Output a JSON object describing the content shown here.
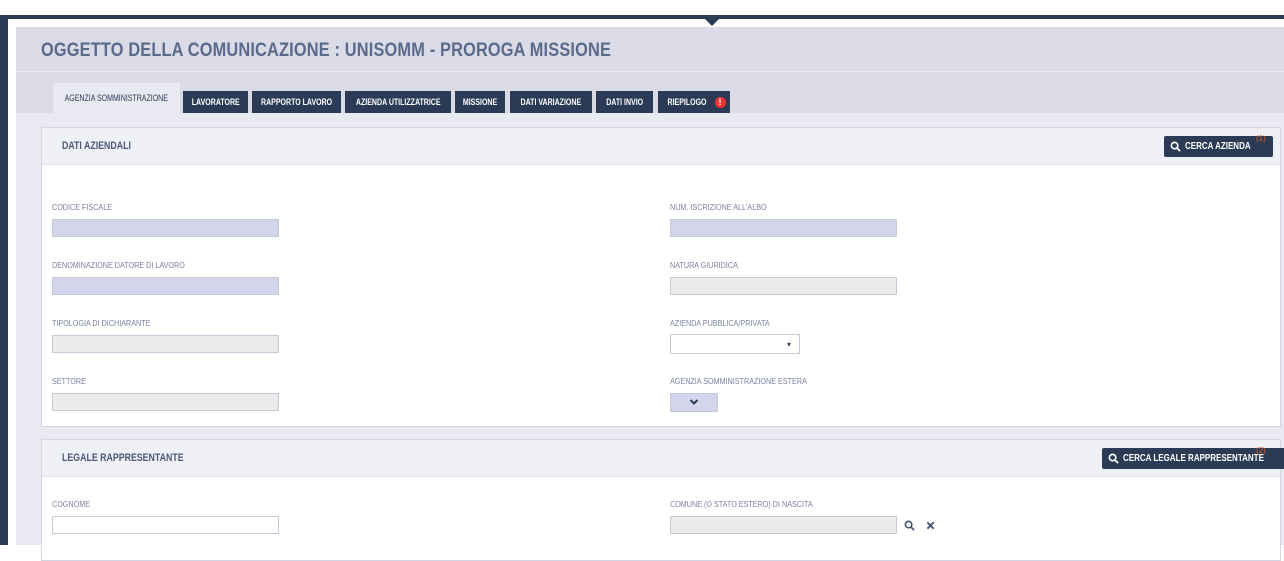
{
  "header": {
    "title": "OGGETTO DELLA COMUNICAZIONE : UNISOMM - PROROGA MISSIONE"
  },
  "tabs": [
    {
      "label": "AGENZIA SOMMINISTRAZIONE",
      "active": true
    },
    {
      "label": "LAVORATORE",
      "active": false
    },
    {
      "label": "RAPPORTO LAVORO",
      "active": false
    },
    {
      "label": "AZIENDA UTILIZZATRICE",
      "active": false
    },
    {
      "label": "MISSIONE",
      "active": false
    },
    {
      "label": "DATI VARIAZIONE",
      "active": false
    },
    {
      "label": "DATI INVIO",
      "active": false
    },
    {
      "label": "RIEPILOGO",
      "active": false,
      "alert": "!"
    }
  ],
  "dati_aziendali": {
    "title": "DATI AZIENDALI",
    "search_label": "CERCA AZIENDA",
    "search_note": "(1)",
    "fields": {
      "codice_fiscale": {
        "label": "CODICE FISCALE",
        "value": ""
      },
      "num_iscrizione": {
        "label": "NUM. ISCRIZIONE ALL'ALBO",
        "value": ""
      },
      "denominazione": {
        "label": "DENOMINAZIONE DATORE DI LAVORO",
        "value": ""
      },
      "natura_giuridica": {
        "label": "NATURA GIURIDICA",
        "value": ""
      },
      "tipologia": {
        "label": "TIPOLOGIA DI DICHIARANTE",
        "value": ""
      },
      "pubblica_privata": {
        "label": "AZIENDA PUBBLICA/PRIVATA",
        "value": ""
      },
      "settore": {
        "label": "SETTORE",
        "value": ""
      },
      "agenzia_estera": {
        "label": "AGENZIA SOMMINISTRAZIONE ESTERA",
        "value": ""
      }
    }
  },
  "legale_rappresentante": {
    "title": "LEGALE RAPPRESENTANTE",
    "search_label": "CERCA LEGALE RAPPRESENTANTE",
    "search_note": "(2)",
    "fields": {
      "cognome": {
        "label": "COGNOME",
        "value": ""
      },
      "comune_nascita": {
        "label": "COMUNE (O STATO ESTERO) DI NASCITA",
        "value": ""
      }
    }
  },
  "icons": {
    "search": "search-icon",
    "clear": "close-icon",
    "dropdown": "chevron-down-icon"
  },
  "colors": {
    "primary": "#2b3a55",
    "panel": "#dadbe7",
    "field_highlight": "#d3d5ea",
    "alert": "#e33333"
  }
}
